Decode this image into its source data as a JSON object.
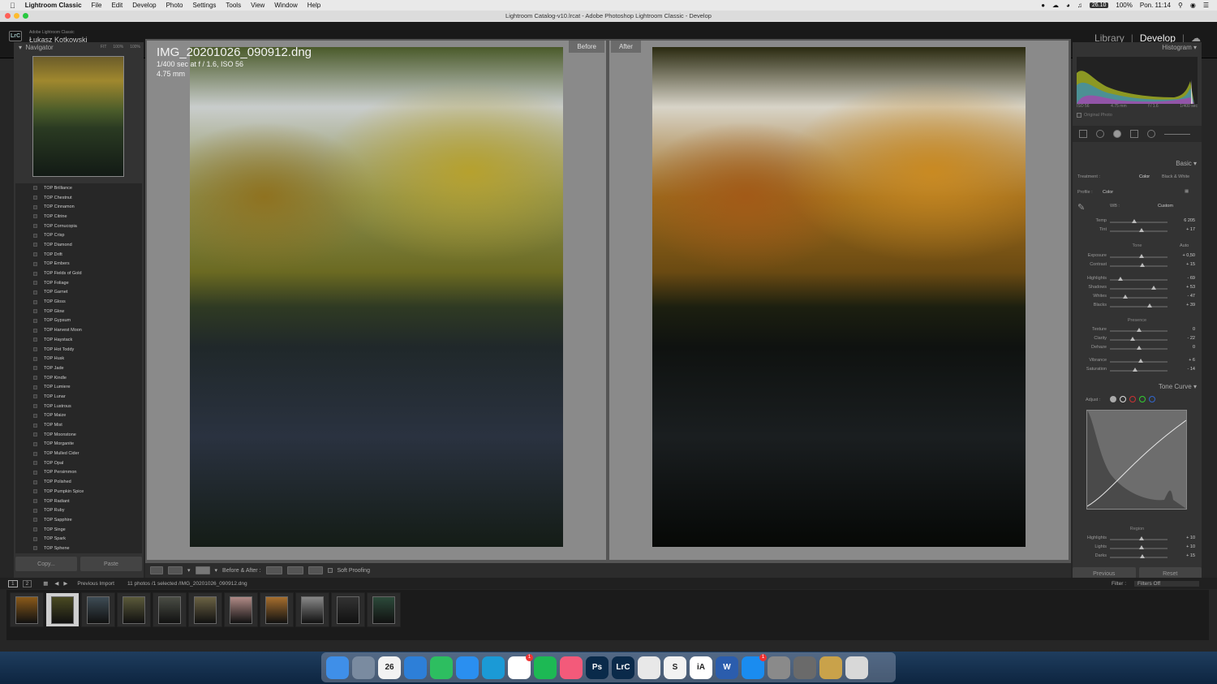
{
  "menubar": {
    "app_name": "Lightroom Classic",
    "menus": [
      "File",
      "Edit",
      "Develop",
      "Photo",
      "Settings",
      "Tools",
      "View",
      "Window",
      "Help"
    ],
    "battery_badge": "26.10",
    "battery": "100%",
    "clock": "Pon. 11:14"
  },
  "window": {
    "title": "Lightroom Catalog-v10.lrcat - Adobe Photoshop Lightroom Classic - Develop"
  },
  "identity": {
    "logo": "LrC",
    "product": "Adobe Lightroom Classic",
    "owner": "Łukasz Kotkowski",
    "modules": [
      "Library",
      "Develop"
    ],
    "active_module": "Develop"
  },
  "navigator": {
    "title": "Navigator",
    "zooms": [
      "FIT",
      "100%",
      "100%"
    ]
  },
  "presets": [
    "TOP Brilliance",
    "TOP Chestnut",
    "TOP Cinnamon",
    "TOP Citrine",
    "TOP Cornucopia",
    "TOP Crisp",
    "TOP Diamond",
    "TOP Drift",
    "TOP Embers",
    "TOP Fields of Gold",
    "TOP Foliage",
    "TOP Garnet",
    "TOP Gloss",
    "TOP Glow",
    "TOP Gypsum",
    "TOP Harvest Moon",
    "TOP Haystack",
    "TOP Hot Toddy",
    "TOP Husk",
    "TOP Jade",
    "TOP Kindle",
    "TOP Lumiere",
    "TOP Lunar",
    "TOP Lustrous",
    "TOP Maize",
    "TOP Mist",
    "TOP Moonstone",
    "TOP Morganite",
    "TOP Mulled Cider",
    "TOP Opal",
    "TOP Persimmon",
    "TOP Polished",
    "TOP Pumpkin Spice",
    "TOP Radiant",
    "TOP Ruby",
    "TOP Sapphire",
    "TOP Singe",
    "TOP Spark",
    "TOP Sphene"
  ],
  "left_buttons": {
    "copy": "Copy...",
    "paste": "Paste"
  },
  "photo": {
    "filename": "IMG_20201026_090912.dng",
    "exposure": "1/400 sec at f / 1.6, ISO 56",
    "focal": "4.75 mm",
    "before_label": "Before",
    "after_label": "After"
  },
  "toolbar": {
    "mode_label": "Before & After :",
    "soft_proofing": "Soft Proofing"
  },
  "histogram": {
    "title": "Histogram",
    "info": [
      "ISO 56",
      "4.75 mm",
      "f / 1.6",
      "1/400 sec"
    ],
    "original_photo": "Original Photo"
  },
  "basic": {
    "title": "Basic",
    "treatment_label": "Treatment :",
    "treatment_options": [
      "Color",
      "Black & White"
    ],
    "profile_label": "Profile :",
    "profile_value": "Color",
    "wb_label": "WB :",
    "wb_value": "Custom",
    "tone_label": "Tone",
    "auto": "Auto",
    "presence_label": "Presence",
    "wb_sliders": [
      {
        "label": "Temp",
        "value": "6 205",
        "pos": 0.42
      },
      {
        "label": "Tint",
        "value": "+ 17",
        "pos": 0.55
      }
    ],
    "tone_sliders": [
      {
        "label": "Exposure",
        "value": "+ 0,50",
        "pos": 0.55
      },
      {
        "label": "Contrast",
        "value": "+ 15",
        "pos": 0.57
      }
    ],
    "tone_sliders2": [
      {
        "label": "Highlights",
        "value": "- 69",
        "pos": 0.18
      },
      {
        "label": "Shadows",
        "value": "+ 53",
        "pos": 0.76
      },
      {
        "label": "Whites",
        "value": "- 47",
        "pos": 0.27
      },
      {
        "label": "Blacks",
        "value": "+ 39",
        "pos": 0.69
      }
    ],
    "presence_sliders": [
      {
        "label": "Texture",
        "value": "0",
        "pos": 0.5
      },
      {
        "label": "Clarity",
        "value": "- 22",
        "pos": 0.39
      },
      {
        "label": "Dehaze",
        "value": "0",
        "pos": 0.5
      }
    ],
    "vib_sliders": [
      {
        "label": "Vibrance",
        "value": "+ 6",
        "pos": 0.53
      },
      {
        "label": "Saturation",
        "value": "- 14",
        "pos": 0.43
      }
    ]
  },
  "tone_curve": {
    "title": "Tone Curve",
    "adjust_label": "Adjust :",
    "region_label": "Region",
    "region_sliders": [
      {
        "label": "Highlights",
        "value": "+ 10",
        "pos": 0.55
      },
      {
        "label": "Lights",
        "value": "+ 10",
        "pos": 0.55
      },
      {
        "label": "Darks",
        "value": "+ 15",
        "pos": 0.57
      }
    ]
  },
  "right_buttons": {
    "previous": "Previous",
    "reset": "Reset"
  },
  "filmbar": {
    "pages": [
      "1",
      "2"
    ],
    "source": "Previous Import",
    "count": "11 photos /1 selected /IMG_20201026_090912.dng",
    "filter_label": "Filter :",
    "filter_value": "Filters Off"
  },
  "filmstrip": {
    "count": 11,
    "selected_index": 1,
    "tones": [
      "#8a5a1a",
      "#4a4a22",
      "#3e4c55",
      "#5b5a3a",
      "#4a4d45",
      "#6b6244",
      "#b08a86",
      "#a66e2e",
      "#888888",
      "#333333",
      "#2c4a3a"
    ]
  },
  "dock": {
    "apps": [
      {
        "name": "finder",
        "label": "",
        "color": "#3f8fe8"
      },
      {
        "name": "launchpad",
        "label": "",
        "color": "#7a8ba0"
      },
      {
        "name": "calendar",
        "label": "26",
        "color": "#f2f2f2"
      },
      {
        "name": "xcode",
        "label": "",
        "color": "#2d7fd8"
      },
      {
        "name": "evernote",
        "label": "",
        "color": "#2dbe60"
      },
      {
        "name": "safari",
        "label": "",
        "color": "#2a8ff0"
      },
      {
        "name": "edge",
        "label": "",
        "color": "#1b9ad6"
      },
      {
        "name": "slack",
        "label": "",
        "color": "#ffffff",
        "badge": "1"
      },
      {
        "name": "spotify",
        "label": "",
        "color": "#1db954"
      },
      {
        "name": "music",
        "label": "",
        "color": "#f35a7a"
      },
      {
        "name": "photoshop",
        "label": "Ps",
        "color": "#0a2a4a"
      },
      {
        "name": "lightroom",
        "label": "LrC",
        "color": "#0a2a4a"
      },
      {
        "name": "chrome",
        "label": "",
        "color": "#e8e8e8"
      },
      {
        "name": "scrivener",
        "label": "S",
        "color": "#f2f2f2"
      },
      {
        "name": "ia-writer",
        "label": "iA",
        "color": "#ffffff"
      },
      {
        "name": "word",
        "label": "W",
        "color": "#2b5dad"
      },
      {
        "name": "app-store",
        "label": "",
        "color": "#1a8cf0",
        "badge": "1"
      },
      {
        "name": "system-preferences",
        "label": "",
        "color": "#8a8a8a"
      },
      {
        "name": "preview",
        "label": "",
        "color": "#6a6a6a"
      },
      {
        "name": "archive",
        "label": "",
        "color": "#c9a24a"
      },
      {
        "name": "trash",
        "label": "",
        "color": "#d8d8d8"
      }
    ]
  }
}
